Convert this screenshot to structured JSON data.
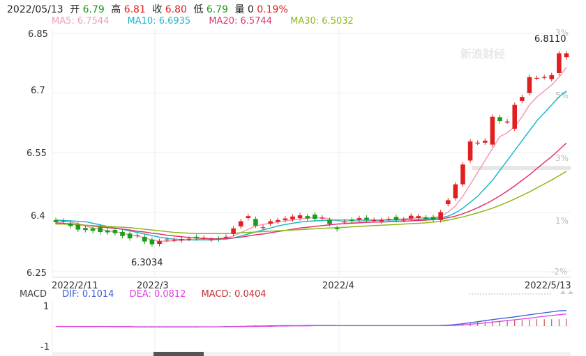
{
  "quote": {
    "date": "2022/05/13",
    "open_label": "开",
    "open": "6.79",
    "high_label": "高",
    "high": "6.81",
    "close_label": "收",
    "close": "6.80",
    "low_label": "低",
    "low": "6.79",
    "volume_label": "量",
    "volume": "0",
    "change": "0.19%"
  },
  "ma_legend": [
    {
      "label": "MA5: 6.7544",
      "color": "#f29ab6"
    },
    {
      "label": "MA10: 6.6935",
      "color": "#1eb6cc"
    },
    {
      "label": "MA20: 6.5744",
      "color": "#e0336e"
    },
    {
      "label": "MA30: 6.5032",
      "color": "#8db816"
    }
  ],
  "watermark": "新浪财经",
  "macd_legend": {
    "title": "MACD",
    "dif": "DIF: 0.1014",
    "dif_color": "#3a5bd9",
    "dea": "DEA: 0.0812",
    "dea_color": "#e040e0",
    "macd": "MACD: 0.0404",
    "macd_color": "#c03030"
  },
  "chart_data": {
    "type": "candlestick",
    "y_ticks": [
      "6.85",
      "6.7",
      "6.55",
      "6.4",
      "6.25"
    ],
    "ylim": [
      6.25,
      6.85
    ],
    "pct_ticks": [
      "3%",
      "5%",
      "3%",
      "1%",
      "-2%"
    ],
    "x_ticks": [
      "2022/2/11",
      "2022/3",
      "2022/4",
      "2022/5/13"
    ],
    "annotations": {
      "max": "6.8110",
      "min": "6.3034"
    },
    "candles": [
      {
        "o": 6.38,
        "c": 6.375
      },
      {
        "o": 6.377,
        "c": 6.378
      },
      {
        "o": 6.372,
        "c": 6.365
      },
      {
        "o": 6.368,
        "c": 6.356
      },
      {
        "o": 6.36,
        "c": 6.355
      },
      {
        "o": 6.359,
        "c": 6.353
      },
      {
        "o": 6.362,
        "c": 6.35
      },
      {
        "o": 6.354,
        "c": 6.349
      },
      {
        "o": 6.355,
        "c": 6.347
      },
      {
        "o": 6.35,
        "c": 6.34
      },
      {
        "o": 6.346,
        "c": 6.334
      },
      {
        "o": 6.342,
        "c": 6.34
      },
      {
        "o": 6.338,
        "c": 6.326
      },
      {
        "o": 6.331,
        "c": 6.319
      },
      {
        "o": 6.32,
        "c": 6.327
      },
      {
        "o": 6.331,
        "c": 6.331
      },
      {
        "o": 6.33,
        "c": 6.33
      },
      {
        "o": 6.329,
        "c": 6.332
      },
      {
        "o": 6.333,
        "c": 6.333
      },
      {
        "o": 6.338,
        "c": 6.334
      },
      {
        "o": 6.335,
        "c": 6.335
      },
      {
        "o": 6.331,
        "c": 6.331
      },
      {
        "o": 6.333,
        "c": 6.332
      },
      {
        "o": 6.338,
        "c": 6.338
      },
      {
        "o": 6.345,
        "c": 6.359
      },
      {
        "o": 6.364,
        "c": 6.377
      },
      {
        "o": 6.385,
        "c": 6.39
      },
      {
        "o": 6.383,
        "c": 6.366
      },
      {
        "o": 6.362,
        "c": 6.362
      },
      {
        "o": 6.371,
        "c": 6.377
      },
      {
        "o": 6.376,
        "c": 6.38
      },
      {
        "o": 6.38,
        "c": 6.384
      },
      {
        "o": 6.382,
        "c": 6.389
      },
      {
        "o": 6.385,
        "c": 6.392
      },
      {
        "o": 6.39,
        "c": 6.384
      },
      {
        "o": 6.394,
        "c": 6.383
      },
      {
        "o": 6.386,
        "c": 6.386
      },
      {
        "o": 6.38,
        "c": 6.37
      },
      {
        "o": 6.36,
        "c": 6.357
      },
      {
        "o": 6.376,
        "c": 6.376
      },
      {
        "o": 6.381,
        "c": 6.378
      },
      {
        "o": 6.381,
        "c": 6.385
      },
      {
        "o": 6.386,
        "c": 6.381
      },
      {
        "o": 6.38,
        "c": 6.38
      },
      {
        "o": 6.377,
        "c": 6.38
      },
      {
        "o": 6.383,
        "c": 6.383
      },
      {
        "o": 6.388,
        "c": 6.38
      },
      {
        "o": 6.381,
        "c": 6.381
      },
      {
        "o": 6.384,
        "c": 6.391
      },
      {
        "o": 6.385,
        "c": 6.39
      },
      {
        "o": 6.387,
        "c": 6.383
      },
      {
        "o": 6.388,
        "c": 6.381
      },
      {
        "o": 6.38,
        "c": 6.4
      },
      {
        "o": 6.42,
        "c": 6.43
      },
      {
        "o": 6.435,
        "c": 6.47
      },
      {
        "o": 6.47,
        "c": 6.52
      },
      {
        "o": 6.53,
        "c": 6.578
      },
      {
        "o": 6.575,
        "c": 6.575
      },
      {
        "o": 6.575,
        "c": 6.58
      },
      {
        "o": 6.57,
        "c": 6.64
      },
      {
        "o": 6.639,
        "c": 6.629
      },
      {
        "o": 6.628,
        "c": 6.628
      },
      {
        "o": 6.61,
        "c": 6.67
      },
      {
        "o": 6.68,
        "c": 6.69
      },
      {
        "o": 6.7,
        "c": 6.74
      },
      {
        "o": 6.738,
        "c": 6.738
      },
      {
        "o": 6.74,
        "c": 6.74
      },
      {
        "o": 6.735,
        "c": 6.745
      },
      {
        "o": 6.75,
        "c": 6.8
      },
      {
        "o": 6.79,
        "c": 6.8
      }
    ],
    "ma_series": [
      {
        "name": "MA5",
        "color": "#f29ab6",
        "values": [
          6.378,
          6.377,
          6.375,
          6.371,
          6.365,
          6.36,
          6.357,
          6.353,
          6.35,
          6.347,
          6.343,
          6.34,
          6.335,
          6.33,
          6.327,
          6.327,
          6.328,
          6.329,
          6.33,
          6.331,
          6.332,
          6.333,
          6.333,
          6.335,
          6.34,
          6.348,
          6.357,
          6.365,
          6.369,
          6.372,
          6.375,
          6.378,
          6.38,
          6.383,
          6.385,
          6.386,
          6.386,
          6.383,
          6.378,
          6.376,
          6.375,
          6.376,
          6.378,
          6.379,
          6.38,
          6.381,
          6.382,
          6.383,
          6.385,
          6.386,
          6.386,
          6.386,
          6.39,
          6.4,
          6.416,
          6.44,
          6.47,
          6.5,
          6.53,
          6.56,
          6.59,
          6.6,
          6.615,
          6.64,
          6.67,
          6.69,
          6.705,
          6.72,
          6.74,
          6.765
        ]
      },
      {
        "name": "MA10",
        "color": "#1eb6cc",
        "values": [
          6.38,
          6.379,
          6.378,
          6.377,
          6.376,
          6.372,
          6.368,
          6.364,
          6.36,
          6.357,
          6.353,
          6.349,
          6.345,
          6.341,
          6.337,
          6.334,
          6.332,
          6.331,
          6.33,
          6.33,
          6.33,
          6.33,
          6.331,
          6.332,
          6.335,
          6.34,
          6.345,
          6.35,
          6.355,
          6.36,
          6.365,
          6.369,
          6.372,
          6.375,
          6.377,
          6.378,
          6.379,
          6.38,
          6.38,
          6.38,
          6.38,
          6.38,
          6.38,
          6.38,
          6.38,
          6.38,
          6.38,
          6.381,
          6.381,
          6.382,
          6.383,
          6.384,
          6.386,
          6.39,
          6.398,
          6.41,
          6.425,
          6.44,
          6.46,
          6.48,
          6.505,
          6.53,
          6.555,
          6.58,
          6.605,
          6.63,
          6.65,
          6.67,
          6.69,
          6.705
        ]
      },
      {
        "name": "MA20",
        "color": "#e0336e",
        "values": [
          6.373,
          6.372,
          6.37,
          6.369,
          6.367,
          6.365,
          6.363,
          6.361,
          6.359,
          6.357,
          6.355,
          6.352,
          6.35,
          6.347,
          6.345,
          6.342,
          6.34,
          6.338,
          6.336,
          6.335,
          6.334,
          6.333,
          6.333,
          6.334,
          6.335,
          6.337,
          6.34,
          6.343,
          6.345,
          6.348,
          6.351,
          6.354,
          6.357,
          6.36,
          6.362,
          6.364,
          6.366,
          6.368,
          6.37,
          6.371,
          6.372,
          6.373,
          6.374,
          6.375,
          6.375,
          6.376,
          6.377,
          6.377,
          6.378,
          6.379,
          6.38,
          6.381,
          6.383,
          6.386,
          6.39,
          6.396,
          6.403,
          6.411,
          6.42,
          6.43,
          6.441,
          6.453,
          6.466,
          6.48,
          6.494,
          6.51,
          6.525,
          6.54,
          6.557,
          6.574
        ]
      },
      {
        "name": "MA30",
        "color": "#8db816",
        "values": [
          6.37,
          6.37,
          6.369,
          6.368,
          6.367,
          6.366,
          6.365,
          6.364,
          6.363,
          6.362,
          6.361,
          6.359,
          6.357,
          6.355,
          6.353,
          6.351,
          6.349,
          6.348,
          6.347,
          6.346,
          6.346,
          6.346,
          6.346,
          6.346,
          6.347,
          6.348,
          6.349,
          6.35,
          6.351,
          6.352,
          6.353,
          6.354,
          6.355,
          6.356,
          6.357,
          6.358,
          6.359,
          6.36,
          6.361,
          6.362,
          6.363,
          6.364,
          6.365,
          6.366,
          6.367,
          6.368,
          6.369,
          6.37,
          6.371,
          6.372,
          6.373,
          6.375,
          6.377,
          6.38,
          6.384,
          6.388,
          6.393,
          6.398,
          6.404,
          6.41,
          6.417,
          6.425,
          6.433,
          6.442,
          6.451,
          6.461,
          6.471,
          6.481,
          6.492,
          6.503
        ]
      }
    ],
    "macd": {
      "ylim": [
        -1,
        1
      ],
      "y_ticks": [
        "1",
        "-1"
      ],
      "dif": [
        -0.02,
        -0.02,
        -0.02,
        -0.02,
        -0.03,
        -0.03,
        -0.03,
        -0.03,
        -0.04,
        -0.04,
        -0.04,
        -0.05,
        -0.05,
        -0.05,
        -0.05,
        -0.05,
        -0.05,
        -0.05,
        -0.05,
        -0.05,
        -0.04,
        -0.04,
        -0.04,
        -0.03,
        -0.03,
        -0.02,
        -0.01,
        0.0,
        0.0,
        0.01,
        0.01,
        0.02,
        0.02,
        0.02,
        0.03,
        0.03,
        0.03,
        0.03,
        0.02,
        0.02,
        0.02,
        0.02,
        0.02,
        0.02,
        0.02,
        0.02,
        0.02,
        0.02,
        0.02,
        0.02,
        0.02,
        0.02,
        0.03,
        0.05,
        0.08,
        0.12,
        0.17,
        0.22,
        0.28,
        0.33,
        0.38,
        0.42,
        0.47,
        0.52,
        0.58,
        0.63,
        0.68,
        0.73,
        0.78,
        0.8
      ],
      "dea": [
        -0.02,
        -0.02,
        -0.02,
        -0.02,
        -0.02,
        -0.02,
        -0.03,
        -0.03,
        -0.03,
        -0.03,
        -0.03,
        -0.04,
        -0.04,
        -0.04,
        -0.04,
        -0.04,
        -0.04,
        -0.04,
        -0.04,
        -0.04,
        -0.04,
        -0.04,
        -0.04,
        -0.04,
        -0.03,
        -0.03,
        -0.02,
        -0.02,
        -0.01,
        -0.01,
        0.0,
        0.0,
        0.01,
        0.01,
        0.01,
        0.02,
        0.02,
        0.02,
        0.02,
        0.02,
        0.02,
        0.02,
        0.02,
        0.02,
        0.02,
        0.02,
        0.02,
        0.02,
        0.02,
        0.02,
        0.02,
        0.02,
        0.02,
        0.03,
        0.04,
        0.06,
        0.09,
        0.12,
        0.16,
        0.2,
        0.24,
        0.28,
        0.32,
        0.36,
        0.4,
        0.45,
        0.5,
        0.54,
        0.58,
        0.62
      ],
      "hist": [
        0,
        0,
        0,
        0,
        -0.01,
        -0.01,
        -0.01,
        -0.01,
        -0.01,
        -0.01,
        -0.01,
        -0.01,
        -0.01,
        -0.01,
        -0.01,
        -0.01,
        -0.01,
        -0.01,
        -0.01,
        -0.01,
        0,
        0,
        0,
        0.01,
        0.01,
        0.02,
        0.02,
        0.03,
        0.03,
        0.03,
        0.03,
        0.03,
        0.03,
        0.03,
        0.03,
        0.03,
        0.03,
        0.02,
        0.02,
        0.01,
        0,
        0,
        0,
        0,
        0,
        0,
        0,
        0,
        0,
        0,
        0,
        0,
        0.02,
        0.05,
        0.08,
        0.12,
        0.16,
        0.2,
        0.24,
        0.26,
        0.28,
        0.28,
        0.3,
        0.32,
        0.34,
        0.35,
        0.35,
        0.35,
        0.35,
        0.36
      ]
    }
  }
}
